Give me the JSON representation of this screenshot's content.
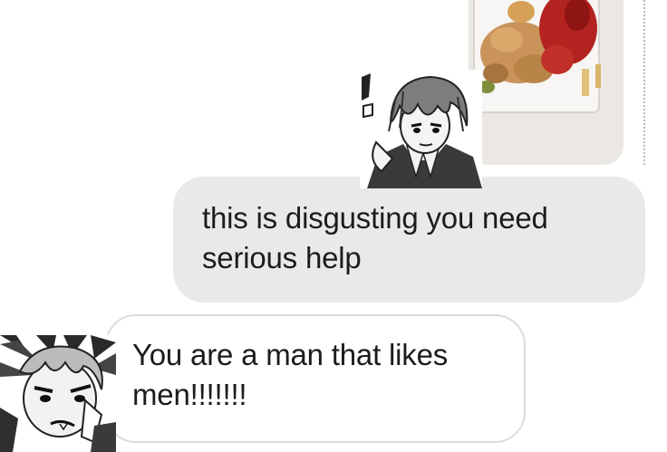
{
  "conversation": {
    "messages": [
      {
        "lines": [
          "this is disgusting you need",
          "serious help"
        ]
      },
      {
        "lines": [
          "You are a man that likes",
          "men!!!!!!!"
        ]
      }
    ],
    "overlay_stickers": [
      "manga-character-sticker",
      "manga-character-sticker"
    ],
    "photo_attachment": {
      "content": "fried-food-with-ketchup-photo"
    }
  },
  "colors": {
    "bubble_gray": "#e9e9eb",
    "bubble_border": "#dcdcde",
    "text": "#1c1c1e",
    "background": "#ffffff"
  }
}
